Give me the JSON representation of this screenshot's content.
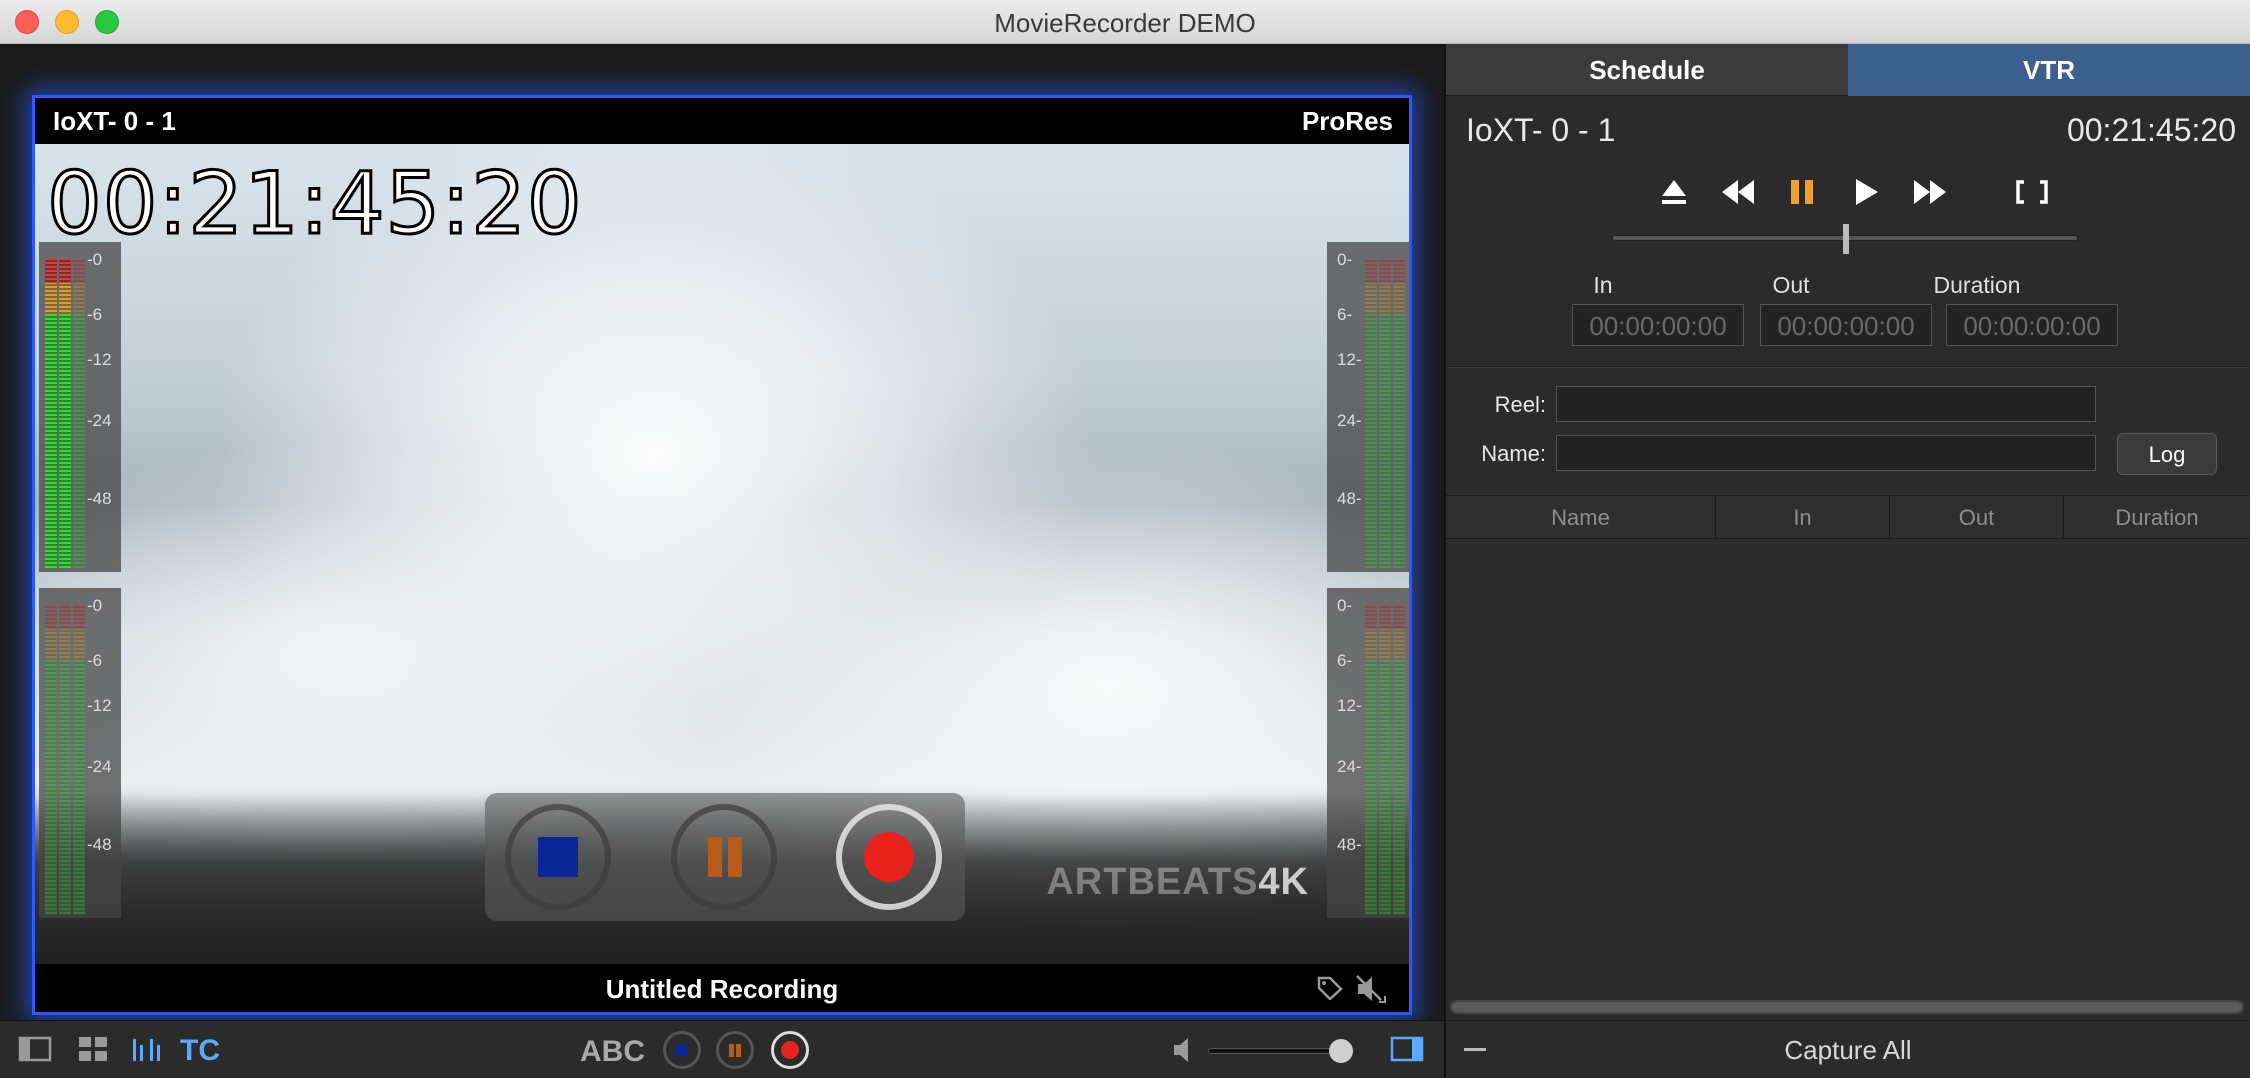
{
  "window": {
    "title": "MovieRecorder DEMO"
  },
  "viewer": {
    "source": "IoXT- 0 - 1",
    "codec": "ProRes",
    "timecode": "00:21:45:20",
    "recording_name": "Untitled Recording",
    "watermark_brand": "ARTBEATS",
    "watermark_res": "4K",
    "meter_ticks_left": [
      "-0",
      "-6",
      "-12",
      "-24",
      "-48"
    ],
    "meter_ticks_right": [
      "0-",
      "6-",
      "12-",
      "24-",
      "48-"
    ]
  },
  "bottom_toolbar": {
    "tc_label": "TC",
    "abc_label": "ABC"
  },
  "panel": {
    "tabs": [
      "Schedule",
      "VTR"
    ],
    "active_tab": "VTR",
    "source": "IoXT- 0 - 1",
    "timecode": "00:21:45:20",
    "in_label": "In",
    "out_label": "Out",
    "duration_label": "Duration",
    "in_value": "00:00:00:00",
    "out_value": "00:00:00:00",
    "duration_value": "00:00:00:00",
    "reel_label": "Reel:",
    "name_label": "Name:",
    "log_button": "Log",
    "columns": [
      "Name",
      "In",
      "Out",
      "Duration"
    ],
    "capture_all": "Capture All"
  },
  "colors": {
    "accent_blue": "#2a5bff",
    "tab_active": "#3c5f8c",
    "pause_orange": "#f0a030",
    "record_red": "#e8231c",
    "stop_blue": "#0a2596"
  }
}
